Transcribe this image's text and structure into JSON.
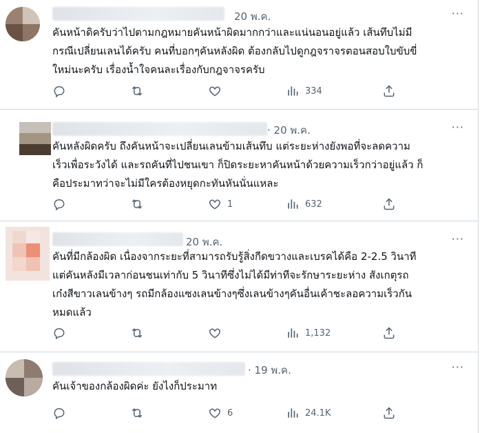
{
  "tweets": [
    {
      "date": "20 พ.ค.",
      "text": "คันหน้าดิครับว่าไปตามกฎหมายคันหน้าผิดมากกว่าและแน่นอนอยู่แล้ว เส้นทึบไม่มี\nกรณีเปลี่ยนเลนได้ครับ คนที่บอกๆคันหลังผิด ต้องกลับไปดูกฎจราจรตอนสอบใบขับขี่\nใหม่นะครับ เรื่องน้ำใจคนละเรื่องกับกฎจาจรครับ",
      "likes": "",
      "views": "334"
    },
    {
      "date": "· 20 พ.ค.",
      "text": "คันหลังผิดครับ ถึงคันหน้าจะเปลี่ยนเลนข้ามเส้นทึบ แต่ระยะห่างยังพอที่จะลดความ\nเร็วเพื่อระวังได้ และรถคันที่ไปชนเขา ก็ปิดระยะหาคันหน้าด้วยความเร็วกว่าอยู่แล้ว ก็\nคือประมาทว่าจะไม่มีใครต้องหยุดกะทันหันนั่นแหละ",
      "likes": "1",
      "views": "632"
    },
    {
      "date": "20 พ.ค.",
      "text": "คันที่มีกล้องผิด เนื่องจากระยะที่สามารถรับรู้สิ่งกีดขวางและเบรคได้คือ 2-2.5 วินาที\nแต่คันหลังมีเวลาก่อนชนเท่ากับ 5 วินาทีซึ่งไม่ได้มีท่าทีจะรักษาระยะห่าง สังเกตุรถ\nเก๋งสีขาวเลนข้างๆ รถมีกล้องแซงเลนข้างๆซึ่งเลนข้างๆคันอื่นเค้าชะลอความเร็วกัน\nหมดแล้ว",
      "likes": "",
      "views": "1,132"
    },
    {
      "date": "· 19 พ.ค.",
      "text": "คันเจ้าของกล้องผิดค่ะ ยังไงก็ประมาท",
      "likes": "6",
      "views": "24.1K"
    }
  ],
  "more_label": "···",
  "icons": [
    "reply-icon",
    "retweet-icon",
    "like-icon",
    "views-icon",
    "share-icon"
  ]
}
